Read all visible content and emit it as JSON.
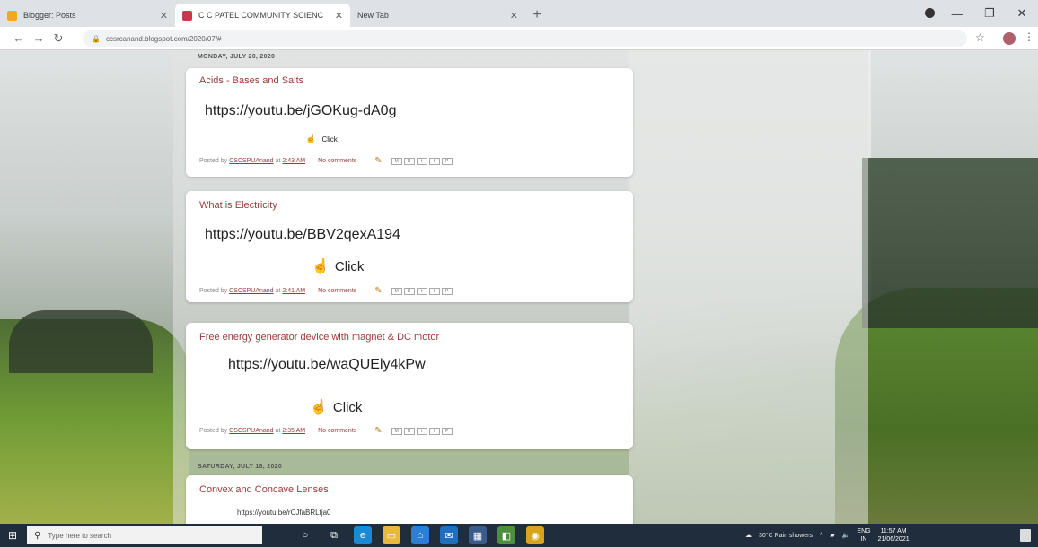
{
  "browser": {
    "tabs": [
      {
        "title": "Blogger: Posts",
        "active": false,
        "favicon_color": "#f4a81d"
      },
      {
        "title": "C C PATEL COMMUNITY SCIENC",
        "active": true,
        "favicon_color": "#c9384a"
      },
      {
        "title": "New Tab",
        "active": false,
        "favicon_color": ""
      }
    ],
    "new_tab_icon": "+",
    "url": "ccsrcanand.blogspot.com/2020/07/#",
    "window_controls": [
      "—",
      "❐",
      "✕"
    ]
  },
  "posts": [
    {
      "date": "MONDAY, JULY 20, 2020",
      "title": "Acids - Bases and Salts",
      "link": "https://youtu.be/jGOKug-dA0g",
      "click": "Click",
      "posted_by": "Posted by",
      "author": "CSCSPUAnand",
      "at": "at",
      "time": "2:43 AM",
      "comments": "No comments"
    },
    {
      "title": "What is Electricity",
      "link": "https://youtu.be/BBV2qexA194",
      "click": "Click",
      "posted_by": "Posted by",
      "author": "CSCSPUAnand",
      "at": "at",
      "time": "2:41 AM",
      "comments": "No comments"
    },
    {
      "title": "Free energy generator device with magnet & DC motor",
      "link": "https://youtu.be/waQUEly4kPw",
      "click": "Click",
      "posted_by": "Posted by",
      "author": "CSCSPUAnand",
      "at": "at",
      "time": "2:35 AM",
      "comments": "No comments"
    },
    {
      "date": "SATURDAY, JULY 18, 2020",
      "title": "Convex and Concave Lenses",
      "link": "https://youtu.be/rCJfaBRLtja0"
    }
  ],
  "taskbar": {
    "search_placeholder": "Type here to search",
    "weather": "30°C  Rain showers",
    "lang": "ENG",
    "lang_sub": "IN",
    "time": "11:57 AM",
    "date": "21/06/2021"
  }
}
